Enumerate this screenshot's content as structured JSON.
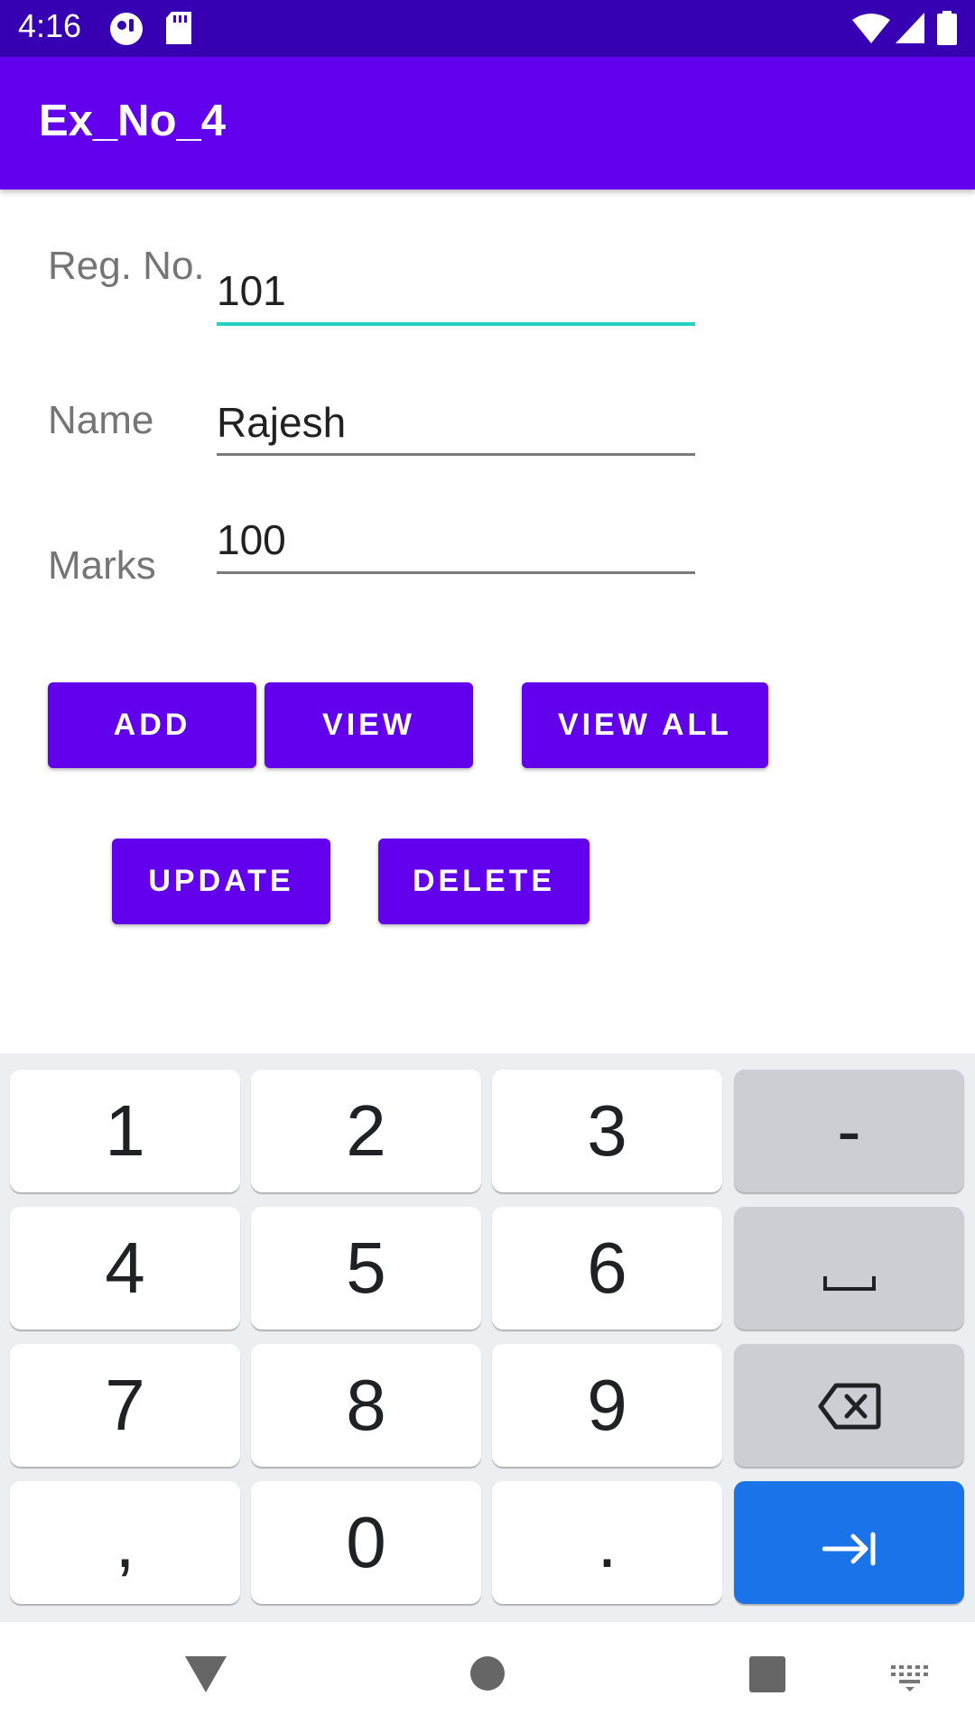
{
  "status_bar": {
    "time": "4:16"
  },
  "app_bar": {
    "title": "Ex_No_4"
  },
  "form": {
    "reg_no": {
      "label": "Reg. No.",
      "value": "101"
    },
    "name": {
      "label": "Name",
      "value": "Rajesh"
    },
    "marks": {
      "label": "Marks",
      "value": "100"
    }
  },
  "buttons": {
    "add": "ADD",
    "view": "VIEW",
    "view_all": "VIEW ALL",
    "update": "UPDATE",
    "delete": "DELETE"
  },
  "keyboard": {
    "keys": [
      "1",
      "2",
      "3",
      "-",
      "4",
      "5",
      "6",
      "7",
      "8",
      "9",
      ",",
      "0",
      "."
    ],
    "icons": [
      "space-icon",
      "backspace-icon",
      "next-field-icon"
    ]
  },
  "nav_bar": {
    "icons": [
      "back-icon",
      "home-icon",
      "recents-icon",
      "keyboard-switch-icon"
    ]
  },
  "colors": {
    "status_bar": "#3700b3",
    "primary": "#6200ee",
    "focus_underline": "#26d0c0",
    "keyboard_action": "#1a73e8"
  }
}
